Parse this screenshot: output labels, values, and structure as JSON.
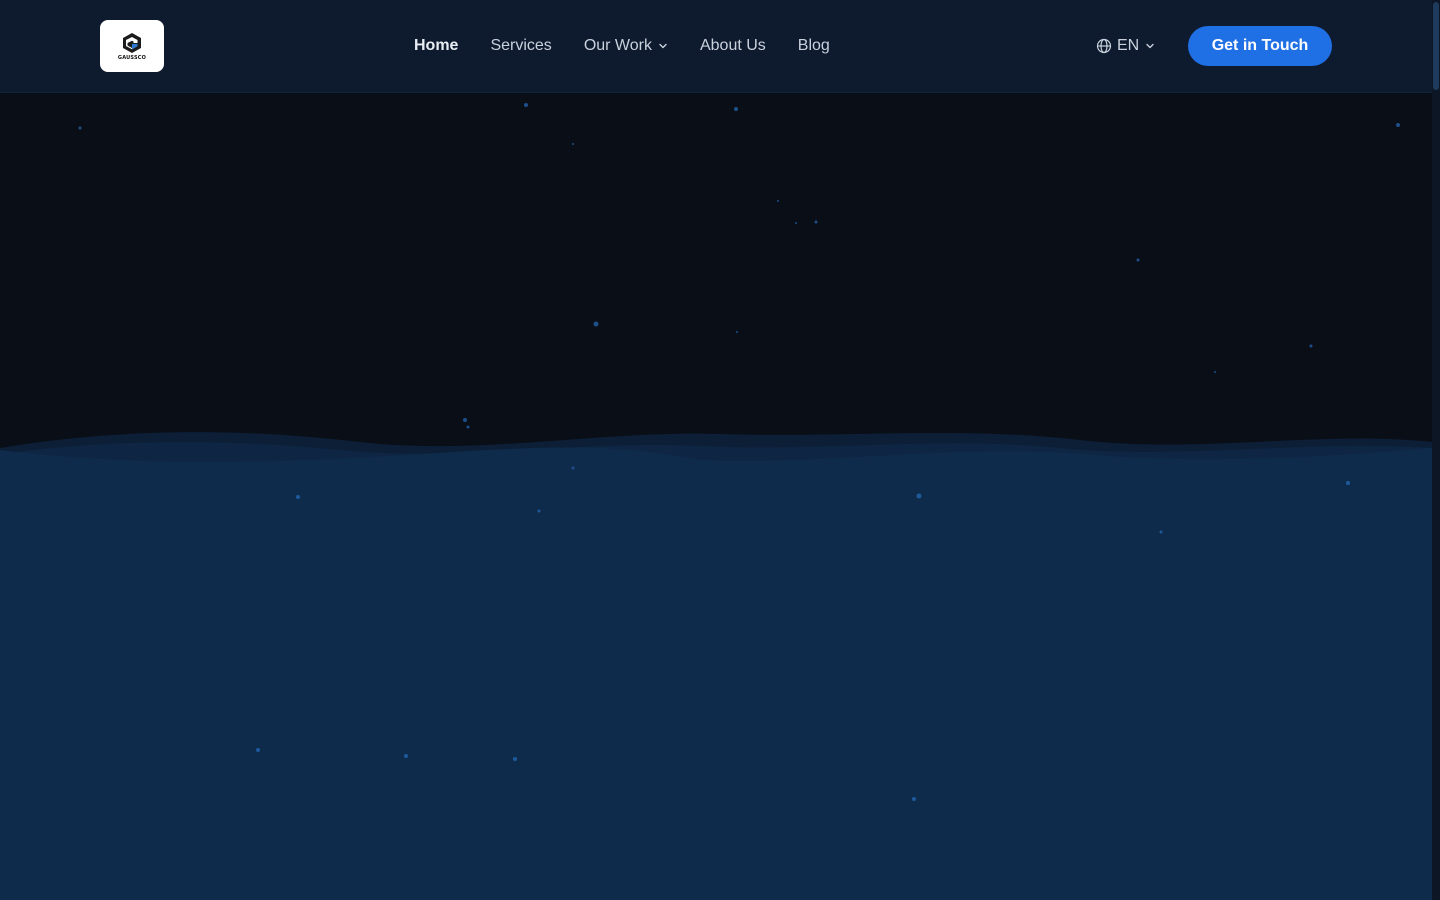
{
  "brand": {
    "logo_text": "GAUSSCO"
  },
  "nav": {
    "items": [
      {
        "label": "Home",
        "active": true,
        "has_dropdown": false
      },
      {
        "label": "Services",
        "active": false,
        "has_dropdown": false
      },
      {
        "label": "Our Work",
        "active": false,
        "has_dropdown": true
      },
      {
        "label": "About Us",
        "active": false,
        "has_dropdown": false
      },
      {
        "label": "Blog",
        "active": false,
        "has_dropdown": false
      }
    ]
  },
  "language": {
    "current": "EN",
    "icon": "globe-icon"
  },
  "cta": {
    "label": "Get in Touch"
  },
  "colors": {
    "nav_background": "#0e1a2e",
    "hero_dark": "#0a0e17",
    "hero_blue": "#0f2b4b",
    "accent": "#1f6fe5",
    "particle": "#1e4f8a"
  }
}
